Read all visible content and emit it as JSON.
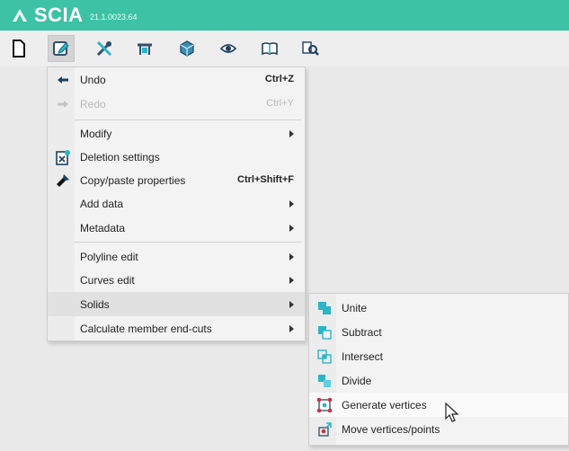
{
  "app": {
    "name": "SCIA",
    "version": "21.1.0023.64"
  },
  "toolbar": {
    "buttons": [
      {
        "name": "new-document-icon"
      },
      {
        "name": "edit-icon",
        "active": true
      },
      {
        "name": "tools-icon"
      },
      {
        "name": "structure-icon"
      },
      {
        "name": "view-3d-icon"
      },
      {
        "name": "eye-icon"
      },
      {
        "name": "book-icon"
      },
      {
        "name": "inspect-icon"
      }
    ]
  },
  "edit_menu": {
    "items": [
      {
        "label": "Undo",
        "shortcut": "Ctrl+Z",
        "icon": "undo-icon"
      },
      {
        "label": "Redo",
        "shortcut": "Ctrl+Y",
        "icon": "redo-icon",
        "disabled": true
      },
      {
        "label": "Modify",
        "submenu": true
      },
      {
        "label": "Deletion settings",
        "icon": "deletion-settings-icon"
      },
      {
        "label": "Copy/paste properties",
        "shortcut": "Ctrl+Shift+F",
        "icon": "brush-icon"
      },
      {
        "label": "Add data",
        "submenu": true
      },
      {
        "label": "Metadata",
        "submenu": true
      },
      {
        "label": "Polyline edit",
        "submenu": true
      },
      {
        "label": "Curves edit",
        "submenu": true
      },
      {
        "label": "Solids",
        "submenu": true,
        "highlight": true
      },
      {
        "label": "Calculate member end-cuts",
        "submenu": true
      }
    ]
  },
  "solids_submenu": {
    "items": [
      {
        "label": "Unite",
        "icon": "unite-icon"
      },
      {
        "label": "Subtract",
        "icon": "subtract-icon"
      },
      {
        "label": "Intersect",
        "icon": "intersect-icon"
      },
      {
        "label": "Divide",
        "icon": "divide-icon"
      },
      {
        "label": "Generate vertices",
        "icon": "generate-vertices-icon",
        "hover": true
      },
      {
        "label": "Move vertices/points",
        "icon": "move-vertices-icon"
      }
    ]
  },
  "colors": {
    "titlebar": "#3ec2a6",
    "accent_teal": "#2ab5c9",
    "menu_bg": "#f3f3f3",
    "highlight": "#e1e1e1"
  }
}
